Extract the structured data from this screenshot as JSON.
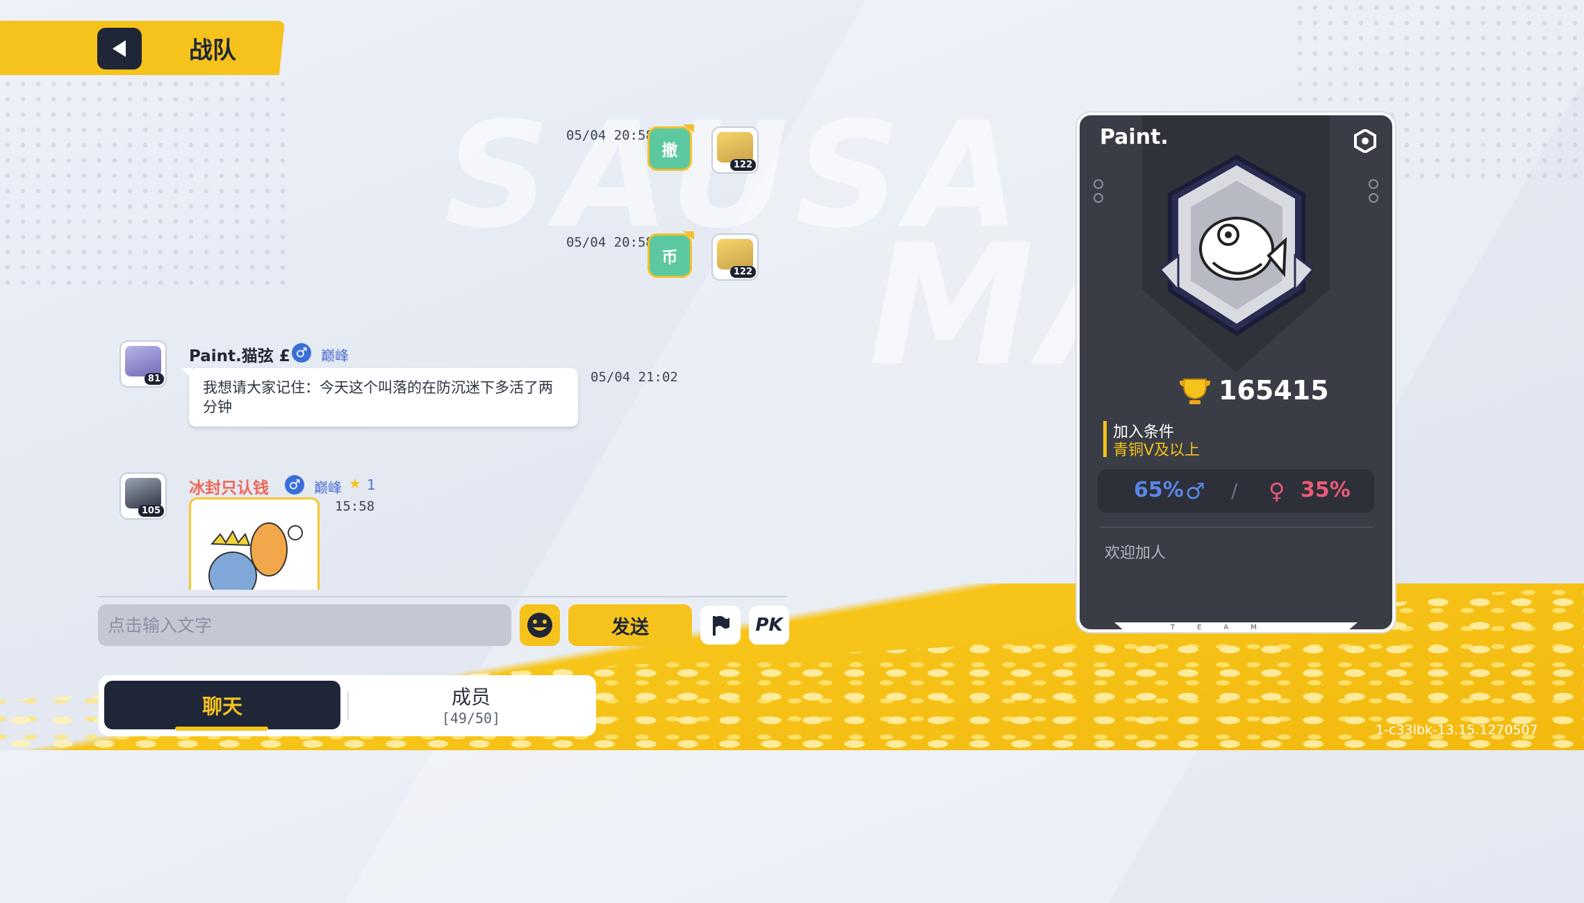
{
  "header": {
    "title": "战队",
    "back_icon": "back-arrow-icon"
  },
  "background": {
    "word1": "SAUSA",
    "word2": "MAN"
  },
  "messages": [
    {
      "time": "05/04 20:58",
      "bubble_text": "撤",
      "avatar_level": "122"
    },
    {
      "time": "05/04 20:58",
      "bubble_text": "币",
      "avatar_level": "122"
    }
  ],
  "chat": [
    {
      "avatar_level": "81",
      "name": "Paint.猫弦 £",
      "gender": "♂",
      "rank": "巅峰",
      "text": "我想请大家记住：今天这个叫落的在防沉迷下多活了两分钟",
      "time": "05/04 21:02"
    },
    {
      "avatar_level": "105",
      "name": "冰封只认钱",
      "gender": "♂",
      "rank": "巅峰",
      "star_count": "1",
      "time": "15:58"
    }
  ],
  "input": {
    "placeholder": "点击输入文字",
    "send_label": "发送",
    "pk_label": "PK"
  },
  "tabs": {
    "chat_label": "聊天",
    "members_label": "成员",
    "members_count": "[49/50]"
  },
  "version": "1-c33lbk-13.15.1270507",
  "team_card": {
    "name": "Paint.",
    "score": "165415",
    "join_label": "加入条件",
    "join_value": "青铜V及以上",
    "male_pct": "65%",
    "male_icon": "♂",
    "female_pct": "35%",
    "female_icon": "♀",
    "slash": "/",
    "welcome": "欢迎加人",
    "footer_letters": "TEAM"
  },
  "colors": {
    "accent": "#f6c21c",
    "dark": "#1e2638",
    "male": "#5a86e8",
    "female": "#ea5a7a",
    "card": "#3a3d45"
  }
}
